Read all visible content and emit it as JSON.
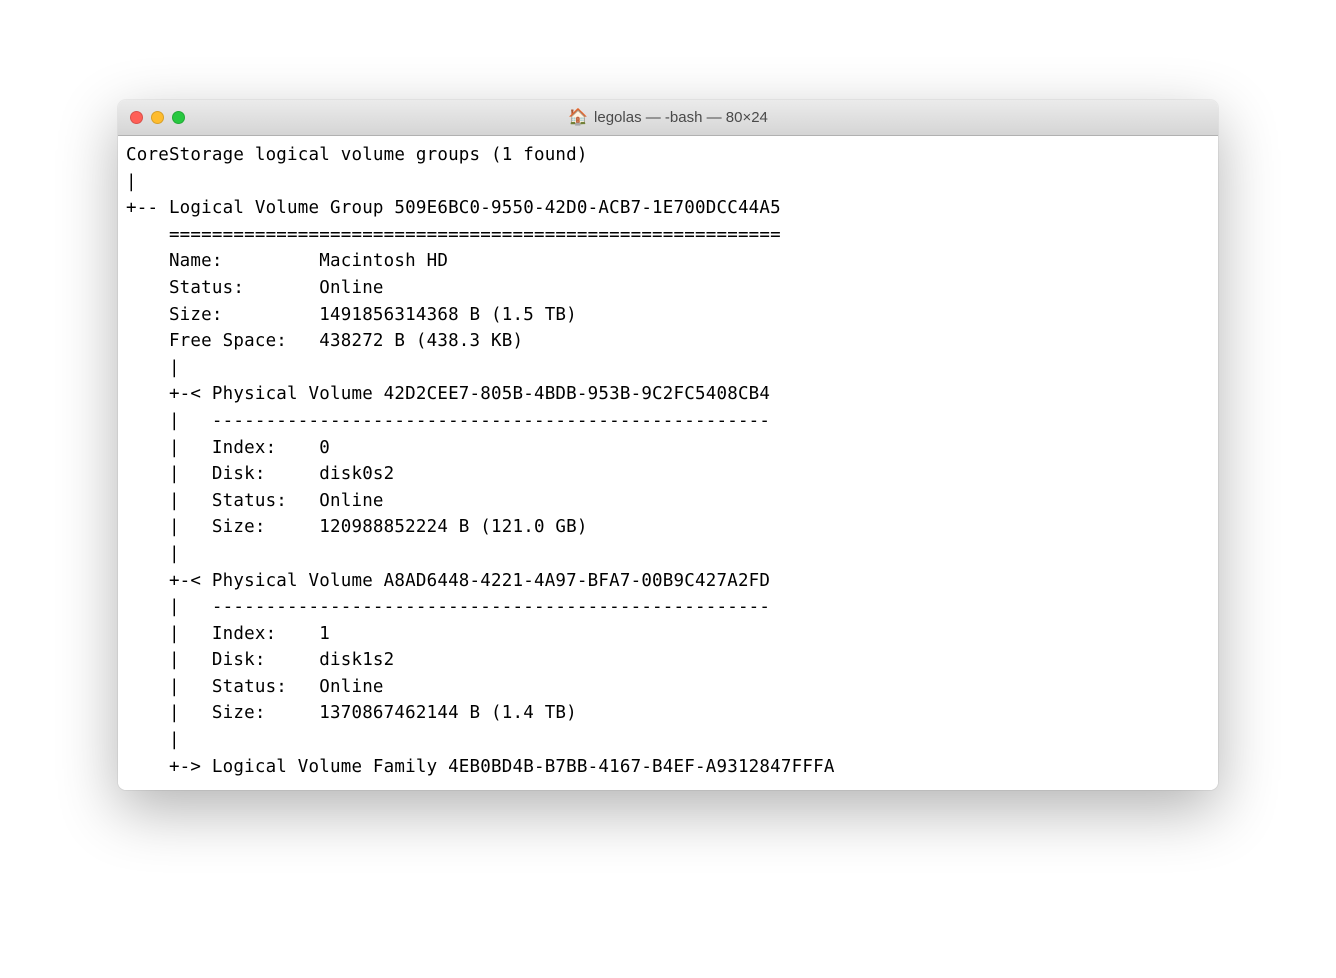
{
  "window": {
    "title": "legolas — -bash — 80×24"
  },
  "terminal": {
    "lines": [
      "CoreStorage logical volume groups (1 found)",
      "|",
      "+-- Logical Volume Group 509E6BC0-9550-42D0-ACB7-1E700DCC44A5",
      "    =========================================================",
      "    Name:         Macintosh HD",
      "    Status:       Online",
      "    Size:         1491856314368 B (1.5 TB)",
      "    Free Space:   438272 B (438.3 KB)",
      "    |",
      "    +-< Physical Volume 42D2CEE7-805B-4BDB-953B-9C2FC5408CB4",
      "    |   ----------------------------------------------------",
      "    |   Index:    0",
      "    |   Disk:     disk0s2",
      "    |   Status:   Online",
      "    |   Size:     120988852224 B (121.0 GB)",
      "    |",
      "    +-< Physical Volume A8AD6448-4221-4A97-BFA7-00B9C427A2FD",
      "    |   ----------------------------------------------------",
      "    |   Index:    1",
      "    |   Disk:     disk1s2",
      "    |   Status:   Online",
      "    |   Size:     1370867462144 B (1.4 TB)",
      "    |",
      "    +-> Logical Volume Family 4EB0BD4B-B7BB-4167-B4EF-A9312847FFFA"
    ]
  }
}
